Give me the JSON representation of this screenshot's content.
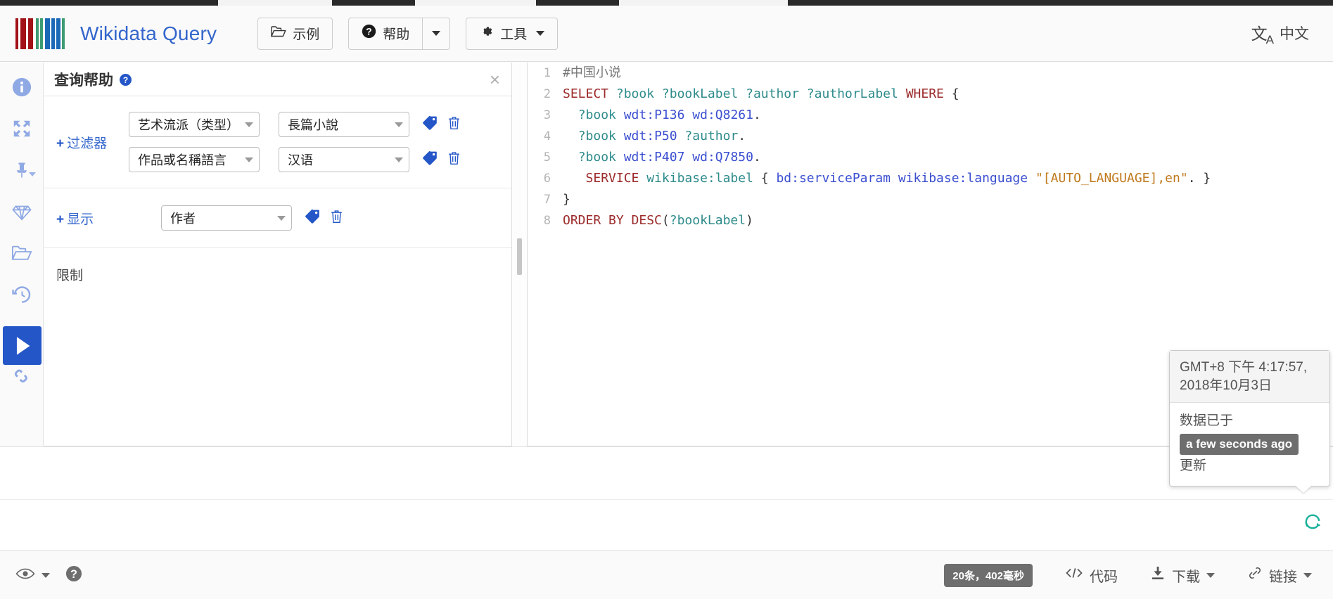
{
  "header": {
    "brand": "Wikidata Query",
    "examples_label": "示例",
    "help_label": "帮助",
    "tools_label": "工具",
    "language_label": "中文",
    "language_icon": "translate-icon",
    "logo_colors": [
      "#a11117",
      "#a11117",
      "#a11117",
      "#3d9c73",
      "#3d9c73",
      "#1b69b6",
      "#1b69b6",
      "#1b69b6",
      "#3d9c73"
    ]
  },
  "rail": {
    "items": [
      {
        "name": "info-icon",
        "title": "信息"
      },
      {
        "name": "expand-icon",
        "title": "全屏"
      },
      {
        "name": "pin-icon",
        "title": "固定"
      },
      {
        "name": "gem-icon",
        "title": "精简"
      },
      {
        "name": "folder-icon",
        "title": "打开"
      },
      {
        "name": "history-icon",
        "title": "历史"
      },
      {
        "name": "trash-icon",
        "title": "清除"
      },
      {
        "name": "link-icon",
        "title": "链接"
      }
    ],
    "run_label": "运行"
  },
  "query_helper": {
    "title": "查询帮助",
    "help_icon_char": "?",
    "close_char": "×",
    "filters_label": "过滤器",
    "show_label": "显示",
    "limit_label": "限制",
    "plus_char": "+",
    "filters": [
      {
        "property": "艺术流派（类型）",
        "value": "長篇小說"
      },
      {
        "property": "作品或名稱語言",
        "value": "汉语"
      }
    ],
    "show_rows": [
      {
        "value": "作者"
      }
    ]
  },
  "editor": {
    "lines": [
      {
        "n": "1",
        "tokens": [
          {
            "t": "#中国小说",
            "c": "k-comment"
          }
        ]
      },
      {
        "n": "2",
        "tokens": [
          {
            "t": "SELECT",
            "c": "k-key"
          },
          {
            "t": " ",
            "c": "k-plain"
          },
          {
            "t": "?book ?bookLabel ?author ?authorLabel",
            "c": "k-var"
          },
          {
            "t": " ",
            "c": "k-plain"
          },
          {
            "t": "WHERE",
            "c": "k-key"
          },
          {
            "t": " {",
            "c": "k-punc"
          }
        ]
      },
      {
        "n": "3",
        "tokens": [
          {
            "t": "  ",
            "c": "k-plain"
          },
          {
            "t": "?book",
            "c": "k-var"
          },
          {
            "t": " ",
            "c": "k-plain"
          },
          {
            "t": "wdt:P136",
            "c": "k-pred"
          },
          {
            "t": " ",
            "c": "k-plain"
          },
          {
            "t": "wd:Q8261",
            "c": "k-pred"
          },
          {
            "t": ".",
            "c": "k-punc"
          }
        ]
      },
      {
        "n": "4",
        "tokens": [
          {
            "t": "  ",
            "c": "k-plain"
          },
          {
            "t": "?book",
            "c": "k-var"
          },
          {
            "t": " ",
            "c": "k-plain"
          },
          {
            "t": "wdt:P50",
            "c": "k-pred"
          },
          {
            "t": " ",
            "c": "k-plain"
          },
          {
            "t": "?author",
            "c": "k-var"
          },
          {
            "t": ".",
            "c": "k-punc"
          }
        ]
      },
      {
        "n": "5",
        "tokens": [
          {
            "t": "  ",
            "c": "k-plain"
          },
          {
            "t": "?book",
            "c": "k-var"
          },
          {
            "t": " ",
            "c": "k-plain"
          },
          {
            "t": "wdt:P407",
            "c": "k-pred"
          },
          {
            "t": " ",
            "c": "k-plain"
          },
          {
            "t": "wd:Q7850",
            "c": "k-pred"
          },
          {
            "t": ".",
            "c": "k-punc"
          }
        ]
      },
      {
        "n": "6",
        "tokens": [
          {
            "t": "   ",
            "c": "k-plain"
          },
          {
            "t": "SERVICE",
            "c": "k-key"
          },
          {
            "t": " ",
            "c": "k-plain"
          },
          {
            "t": "wikibase:label",
            "c": "k-var"
          },
          {
            "t": " { ",
            "c": "k-punc"
          },
          {
            "t": "bd:serviceParam",
            "c": "k-pred"
          },
          {
            "t": " ",
            "c": "k-plain"
          },
          {
            "t": "wikibase:language",
            "c": "k-pred"
          },
          {
            "t": " ",
            "c": "k-plain"
          },
          {
            "t": "\"[AUTO_LANGUAGE],en\"",
            "c": "k-str"
          },
          {
            "t": ". }",
            "c": "k-punc"
          }
        ]
      },
      {
        "n": "7",
        "tokens": [
          {
            "t": "}",
            "c": "k-punc"
          }
        ]
      },
      {
        "n": "8",
        "tokens": [
          {
            "t": "ORDER BY DESC",
            "c": "k-key"
          },
          {
            "t": "(",
            "c": "k-punc"
          },
          {
            "t": "?bookLabel",
            "c": "k-var"
          },
          {
            "t": ")",
            "c": "k-punc"
          }
        ]
      }
    ]
  },
  "tooltip": {
    "timestamp": "GMT+8 下午 4:17:57, 2018年10月3日",
    "prefix": "数据已于",
    "badge": "a few seconds ago",
    "suffix": "更新"
  },
  "footer": {
    "eye_icon": "eye-icon",
    "help_icon": "help-circle-icon",
    "stats": "20条，402毫秒",
    "code_label": "代码",
    "download_label": "下载",
    "link_label": "链接"
  }
}
